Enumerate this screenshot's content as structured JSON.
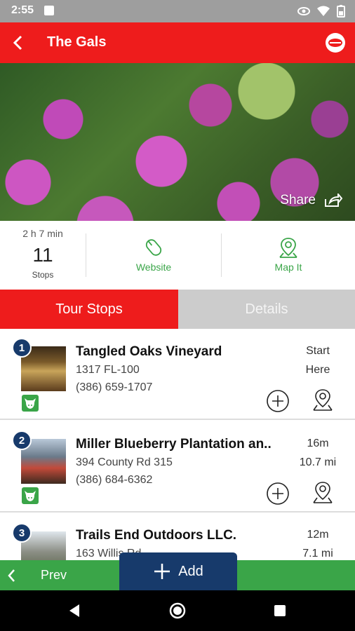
{
  "status_bar": {
    "time": "2:55"
  },
  "app_bar": {
    "title": "The Gals"
  },
  "hero": {
    "share_label": "Share"
  },
  "info": {
    "duration": "2 h 7 min",
    "stops_count": "11",
    "stops_label": "Stops",
    "website_label": "Website",
    "map_label": "Map It"
  },
  "tabs": [
    {
      "label": "Tour Stops",
      "active": true
    },
    {
      "label": "Details",
      "active": false
    }
  ],
  "stops": [
    {
      "number": "1",
      "name": "Tangled Oaks Vineyard",
      "address": "1317 FL-100",
      "phone": "(386) 659-1707",
      "meta1": "Start",
      "meta2": "Here"
    },
    {
      "number": "2",
      "name": "Miller Blueberry Plantation an..",
      "address": "394 County Rd 315",
      "phone": "(386) 684-6362",
      "meta1": "16m",
      "meta2": "10.7 mi"
    },
    {
      "number": "3",
      "name": "Trails End Outdoors LLC.",
      "address": "163 Willis Rd",
      "phone": "",
      "meta1": "12m",
      "meta2": "7.1 mi"
    }
  ],
  "bottom_bar": {
    "prev_label": "Prev",
    "add_label": "Add"
  },
  "colors": {
    "primary_red": "#ee1c1c",
    "accent_green": "#3aa548",
    "navy": "#173a6b"
  }
}
